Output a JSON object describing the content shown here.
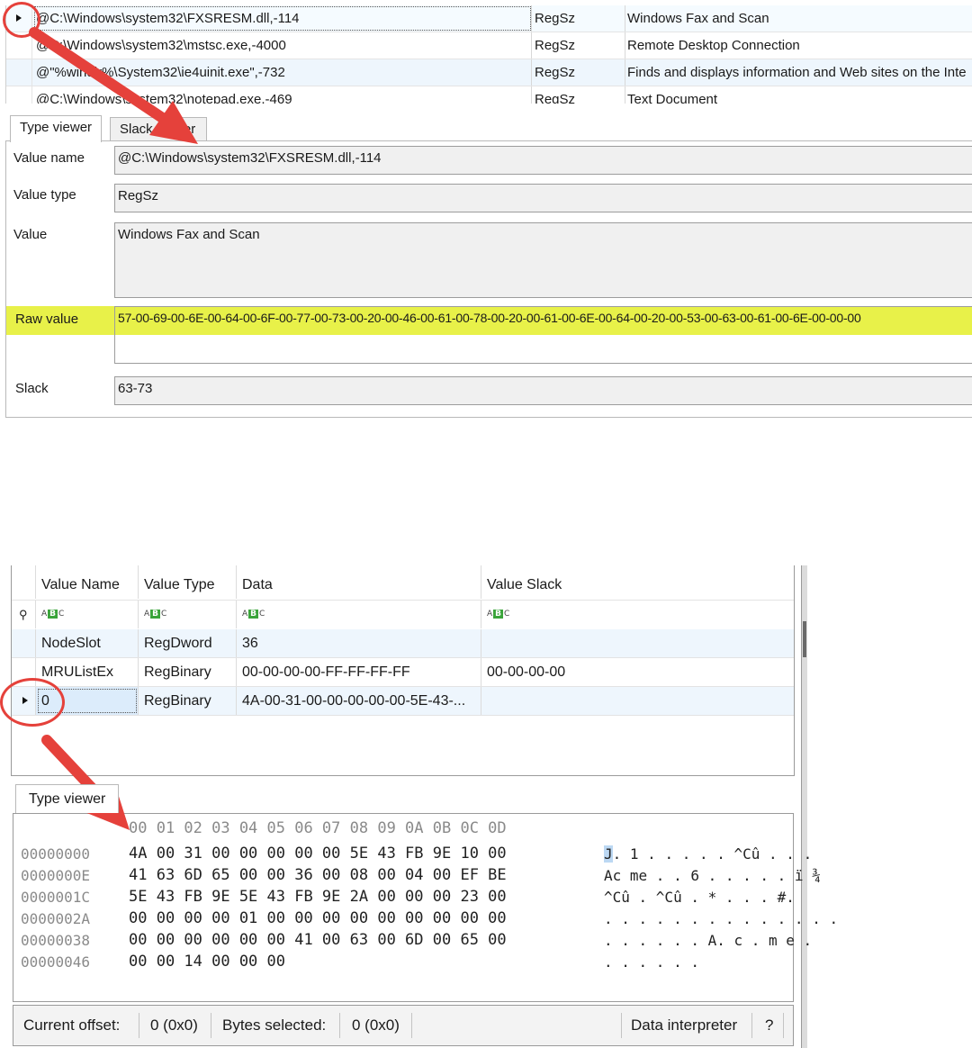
{
  "top": {
    "rows": [
      {
        "name": "@C:\\Windows\\system32\\FXSRESM.dll,-114",
        "type": "RegSz",
        "value": "Windows Fax and Scan"
      },
      {
        "name": "@C:\\Windows\\system32\\mstsc.exe,-4000",
        "type": "RegSz",
        "value": "Remote Desktop Connection"
      },
      {
        "name": "@\"%windir%\\System32\\ie4uinit.exe\",-732",
        "type": "RegSz",
        "value": "Finds and displays information and Web sites on the Inte"
      },
      {
        "name": "@C:\\Windows\\system32\\notepad.exe,-469",
        "type": "RegSz",
        "value": "Text Document"
      }
    ],
    "tabs": [
      "Type viewer",
      "Slack viewer"
    ],
    "fields": {
      "value_name_label": "Value name",
      "value_name": "@C:\\Windows\\system32\\FXSRESM.dll,-114",
      "value_type_label": "Value type",
      "value_type": "RegSz",
      "value_label": "Value",
      "value": "Windows Fax and Scan",
      "raw_value_label": "Raw value",
      "raw_value": "57-00-69-00-6E-00-64-00-6F-00-77-00-73-00-20-00-46-00-61-00-78-00-20-00-61-00-6E-00-64-00-20-00-53-00-63-00-61-00-6E-00-00-00",
      "slack_label": "Slack",
      "slack": "63-73"
    },
    "highlight_color": "#e8f149"
  },
  "bottom": {
    "columns": [
      "Value Name",
      "Value Type",
      "Data",
      "Value Slack"
    ],
    "filter_icon": "abc-filter-icon",
    "rows": [
      {
        "name": "NodeSlot",
        "type": "RegDword",
        "data": "36",
        "slack": ""
      },
      {
        "name": "MRUListEx",
        "type": "RegBinary",
        "data": "00-00-00-00-FF-FF-FF-FF",
        "slack": "00-00-00-00"
      },
      {
        "name": "0",
        "type": "RegBinary",
        "data": "4A-00-31-00-00-00-00-00-5E-43-...",
        "slack": ""
      }
    ],
    "tab": "Type viewer",
    "hex": {
      "header": "00 01 02 03 04 05 06 07 08 09 0A 0B 0C 0D",
      "lines": [
        {
          "offset": "00000000",
          "bytes": "4A 00 31 00 00 00 00 00 5E 43 FB 9E 10 00",
          "ascii_hl": "J",
          "ascii": ". 1 . . . . . ^Cû . . ."
        },
        {
          "offset": "0000000E",
          "bytes": "41 63 6D 65 00 00 36 00 08 00 04 00 EF BE",
          "ascii_hl": "",
          "ascii": "Ac me . . 6 . . . . . ï ¾"
        },
        {
          "offset": "0000001C",
          "bytes": "5E 43 FB 9E 5E 43 FB 9E 2A 00 00 00 23 00",
          "ascii_hl": "",
          "ascii": "^Cû . ^Cû . * . . . #."
        },
        {
          "offset": "0000002A",
          "bytes": "00 00 00 00 01 00 00 00 00 00 00 00 00 00",
          "ascii_hl": "",
          "ascii": ". . . . . . . . . . . . . ."
        },
        {
          "offset": "00000038",
          "bytes": "00 00 00 00 00 00 41 00 63 00 6D 00 65 00",
          "ascii_hl": "",
          "ascii": ". . . . . . A. c . m e ."
        },
        {
          "offset": "00000046",
          "bytes": "00 00 14 00 00 00",
          "ascii_hl": "",
          "ascii": ". . . . . ."
        }
      ]
    },
    "status": {
      "current_offset_label": "Current offset:",
      "current_offset": "0 (0x0)",
      "bytes_selected_label": "Bytes selected:",
      "bytes_selected": "0 (0x0)",
      "data_interpreter": "Data interpreter",
      "help": "?"
    }
  },
  "annotation_color": "#e5413b"
}
